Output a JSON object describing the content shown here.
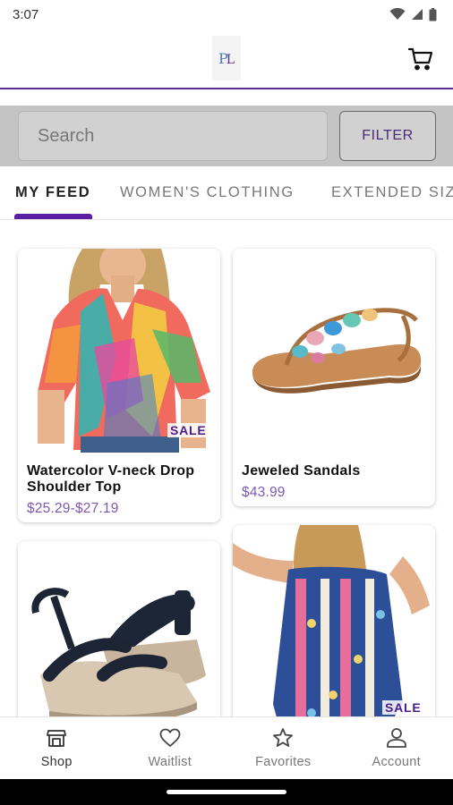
{
  "status_bar": {
    "time": "3:07"
  },
  "header": {
    "logo_text": "PL",
    "cart_icon": "cart-icon"
  },
  "search": {
    "placeholder": "Search",
    "filter_label": "FILTER"
  },
  "tabs": [
    {
      "label": "MY FEED",
      "active": true
    },
    {
      "label": "WOMEN'S CLOTHING",
      "active": false
    },
    {
      "label": "EXTENDED SIZES",
      "active": false
    }
  ],
  "products": [
    {
      "title": "Watercolor V-neck Drop Shoulder Top",
      "price": "$25.29-$27.19",
      "badge": "SALE"
    },
    {
      "title": "Jeweled Sandals",
      "price": "$43.99",
      "badge": ""
    },
    {
      "title": "",
      "price": "",
      "badge": ""
    },
    {
      "title": "",
      "price": "",
      "badge": "SALE"
    }
  ],
  "bottom_nav": [
    {
      "label": "Shop",
      "icon": "shop-icon",
      "active": true
    },
    {
      "label": "Waitlist",
      "icon": "heart-icon",
      "active": false
    },
    {
      "label": "Favorites",
      "icon": "star-icon",
      "active": false
    },
    {
      "label": "Account",
      "icon": "account-icon",
      "active": false
    }
  ],
  "colors": {
    "accent": "#5b1fa0",
    "price": "#7e57b2",
    "sale": "#4b1c8c"
  }
}
